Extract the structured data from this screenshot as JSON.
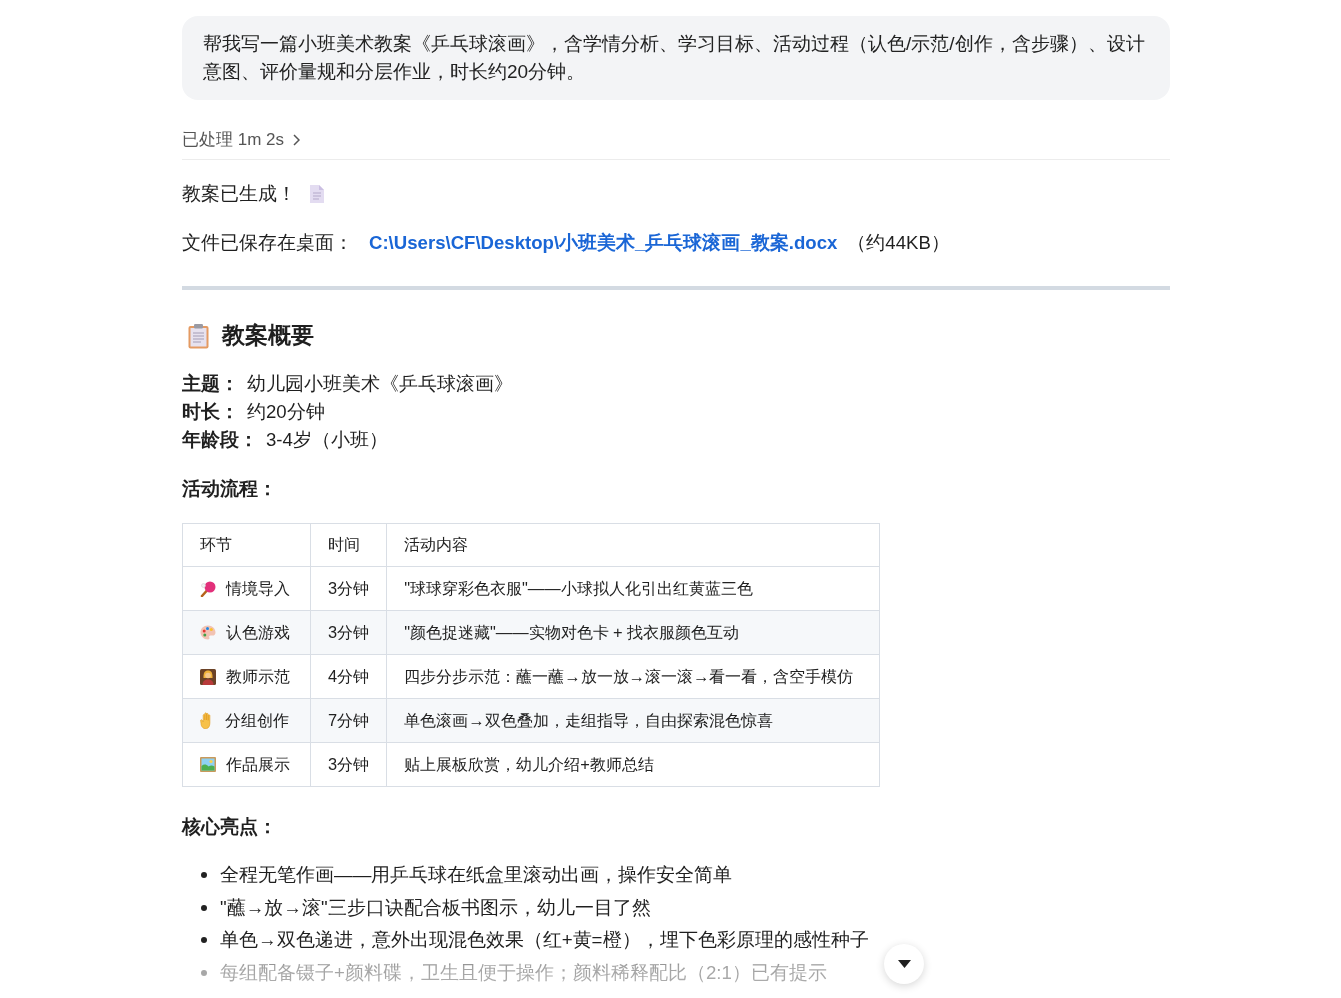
{
  "prompt_bubble": {
    "text": "帮我写一篇小班美术教案《乒乓球滚画》，含学情分析、学习目标、活动过程（认色/示范/创作，含步骤）、设计意图、评价量规和分层作业，时长约20分钟。"
  },
  "thinking": {
    "label": "已处理 1m 2s",
    "expanded": false
  },
  "status": {
    "text": "教案已生成！"
  },
  "saved_file": {
    "prefix": "文件已保存在桌面：",
    "link": "C:\\Users\\CF\\Desktop\\小班美术_乒乓球滚画_教案.docx",
    "suffix": "（约44KB）"
  },
  "overview": {
    "heading": "教案概要",
    "fields": [
      {
        "label": "主题：",
        "value": "幼儿园小班美术《乒乓球滚画》"
      },
      {
        "label": "时长：",
        "value": "约20分钟"
      },
      {
        "label": "年龄段：",
        "value": "3-4岁（小班）"
      }
    ]
  },
  "flow_heading": "活动流程：",
  "table": {
    "columns": [
      "环节",
      "时间",
      "活动内容"
    ],
    "rows": [
      {
        "stage": "情境导入",
        "time": "3分钟",
        "content": "\"球球穿彩色衣服\"——小球拟人化引出红黄蓝三色"
      },
      {
        "stage": "认色游戏",
        "time": "3分钟",
        "content": "\"颜色捉迷藏\"——实物对色卡 + 找衣服颜色互动"
      },
      {
        "stage": "教师示范",
        "time": "4分钟",
        "content": "四步分步示范：蘸一蘸→放一放→滚一滚→看一看，含空手模仿"
      },
      {
        "stage": "分组创作",
        "time": "7分钟",
        "content": "单色滚画→双色叠加，走组指导，自由探索混色惊喜"
      },
      {
        "stage": "作品展示",
        "time": "3分钟",
        "content": "贴上展板欣赏，幼儿介绍+教师总结"
      }
    ]
  },
  "highlights_heading": "核心亮点：",
  "highlights": [
    "全程无笔作画——用乒乓球在纸盒里滚动出画，操作安全简单",
    "\"蘸→放→滚\"三步口诀配合板书图示，幼儿一目了然",
    "单色→双色递进，意外出现混色效果（红+黄=橙），埋下色彩原理的感性种子",
    "每组配备镊子+颜料碟，卫生且便于操作；颜料稀释配比（2:1）已有提示"
  ]
}
